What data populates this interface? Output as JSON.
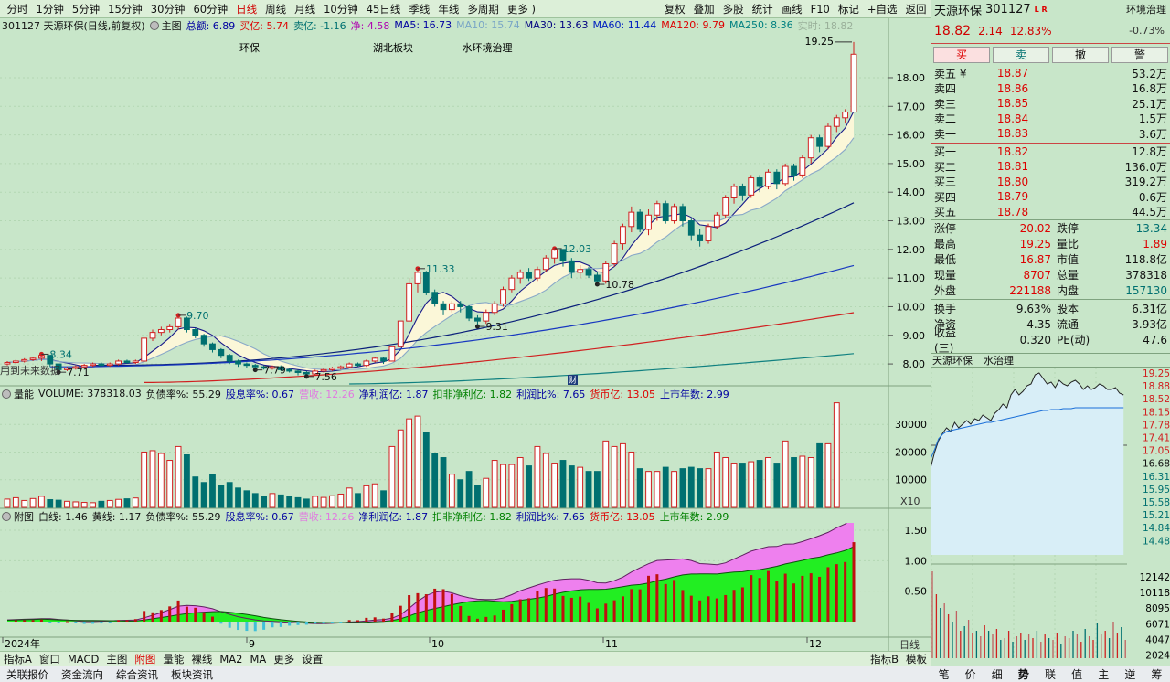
{
  "toolbar": {
    "items": [
      "分时",
      "1分钟",
      "5分钟",
      "15分钟",
      "30分钟",
      "60分钟",
      "日线",
      "周线",
      "月线",
      "10分钟",
      "45日线",
      "季线",
      "年线",
      "多周期",
      "更多 )"
    ],
    "active": "日线",
    "right": [
      "复权",
      "叠加",
      "多股",
      "统计",
      "画线",
      "F10",
      "标记",
      "+自选",
      "返回"
    ]
  },
  "info": {
    "code_name": "301127 天源环保(日线,前复权)",
    "main_label": "主图",
    "amount": "总额: 6.89",
    "buy_yi": "买亿: 5.74",
    "sell_yi": "卖亿: -1.16",
    "net": "净: 4.58",
    "ma5": "MA5: 16.73",
    "ma10": "MA10: 15.74",
    "ma30": "MA30: 13.63",
    "ma60": "MA60: 11.44",
    "ma120": "MA120: 9.79",
    "ma250": "MA250: 8.36",
    "realtime": "实时: 18.82"
  },
  "tags": [
    "环保",
    "湖北板块",
    "水环境治理"
  ],
  "chart_note": "用到未来数据",
  "vol_info": {
    "label": "量能",
    "volume": "VOLUME: 378318.03",
    "f1": "负债率%: 55.29",
    "f2": "股息率%: 0.67",
    "f3": "营收: 12.26",
    "f4": "净利润亿: 1.87",
    "f5": "扣非净利亿: 1.82",
    "f6": "利润比%: 7.65",
    "f7": "货币亿: 13.05",
    "f8": "上市年数: 2.99"
  },
  "sub_info": {
    "label": "附图",
    "white": "白线: 1.46",
    "yellow": "黄线: 1.17",
    "f1": "负债率%: 55.29",
    "f2": "股息率%: 0.67",
    "f3": "营收: 12.26",
    "f4": "净利润亿: 1.87",
    "f5": "扣非净利亿: 1.82",
    "f6": "利润比%: 7.65",
    "f7": "货币亿: 13.05",
    "f8": "上市年数: 2.99"
  },
  "bottom_bar": {
    "items": [
      "指标A",
      "窗口",
      "MACD",
      "主图",
      "附图",
      "量能",
      "裸线",
      "MA2",
      "MA",
      "更多",
      "设置"
    ],
    "active": "附图",
    "right": [
      "指标B",
      "模板"
    ]
  },
  "status_bar": [
    "关联报价",
    "资金流向",
    "综合资讯",
    "板块资讯"
  ],
  "side_labels": {
    "x10": "X10",
    "daily": "日线"
  },
  "quote": {
    "name": "天源环保",
    "code": "301127",
    "lr": "L R",
    "industry": "环境治理",
    "price": "18.82",
    "change": "2.14",
    "pct": "12.83%",
    "ind_pct": "-0.73%",
    "buttons": [
      "买",
      "卖",
      "撤",
      "警"
    ],
    "sell": [
      {
        "label": "卖五 ¥",
        "price": "18.87",
        "vol": "53.2万"
      },
      {
        "label": "卖四",
        "price": "18.86",
        "vol": "16.8万"
      },
      {
        "label": "卖三",
        "price": "18.85",
        "vol": "25.1万"
      },
      {
        "label": "卖二",
        "price": "18.84",
        "vol": "1.5万"
      },
      {
        "label": "卖一",
        "price": "18.83",
        "vol": "3.6万"
      }
    ],
    "buy": [
      {
        "label": "买一",
        "price": "18.82",
        "vol": "12.8万"
      },
      {
        "label": "买二",
        "price": "18.81",
        "vol": "136.0万"
      },
      {
        "label": "买三",
        "price": "18.80",
        "vol": "319.2万"
      },
      {
        "label": "买四",
        "price": "18.79",
        "vol": "0.6万"
      },
      {
        "label": "买五",
        "price": "18.78",
        "vol": "44.5万"
      }
    ],
    "stats": [
      {
        "a": "涨停",
        "b": "20.02",
        "c": "跌停",
        "d": "13.34"
      },
      {
        "a": "最高",
        "b": "19.25",
        "c": "量比",
        "d": "1.89"
      },
      {
        "a": "最低",
        "b": "16.87",
        "c": "市值",
        "d": "118.8亿"
      },
      {
        "a": "现量",
        "b": "8707",
        "c": "总量",
        "d": "378318"
      },
      {
        "a": "外盘",
        "b": "221188",
        "c": "内盘",
        "d": "157130"
      }
    ],
    "stats2": [
      {
        "a": "换手",
        "b": "9.63%",
        "c": "股本",
        "d": "6.31亿"
      },
      {
        "a": "净资",
        "b": "4.35",
        "c": "流通",
        "d": "3.93亿"
      },
      {
        "a": "收益(三)",
        "b": "0.320",
        "c": "PE(动)",
        "d": "47.6"
      }
    ]
  },
  "mini_tabs": [
    "天源环保",
    "水治理"
  ],
  "mini_axis": [
    "19.25",
    "18.88",
    "18.52",
    "18.15",
    "17.78",
    "17.41",
    "17.05",
    "16.68",
    "16.31",
    "15.95",
    "15.58",
    "15.21",
    "14.84",
    "14.48",
    "12142",
    "10118",
    "8095",
    "6071",
    "4047",
    "2024"
  ],
  "mini_tabs_bottom": [
    "笔",
    "价",
    "细",
    "势",
    "联",
    "值",
    "主",
    "逆",
    "筹"
  ],
  "mini_active": "势",
  "chart_data": {
    "type": "candlestick",
    "price_axis": [
      "18.00",
      "17.00",
      "16.00",
      "15.00",
      "14.00",
      "13.00",
      "12.00",
      "11.00",
      "10.00",
      "9.00",
      "8.00"
    ],
    "vol_axis": [
      "30000",
      "20000",
      "10000"
    ],
    "sub_axis": [
      "1.50",
      "1.00",
      "0.50"
    ],
    "date_labels": [
      "2024年",
      "9",
      "10",
      "11",
      "12"
    ],
    "annotations": [
      {
        "text": "8.34",
        "value": 8.34
      },
      {
        "text": "7.71",
        "value": 7.71
      },
      {
        "text": "9.70",
        "value": 9.7
      },
      {
        "text": "7.79",
        "value": 7.79
      },
      {
        "text": "7.56",
        "value": 7.56
      },
      {
        "text": "11.33",
        "value": 11.33
      },
      {
        "text": "9.31",
        "value": 9.31
      },
      {
        "text": "12.03",
        "value": 12.03
      },
      {
        "text": "10.78",
        "value": 10.78
      },
      {
        "text": "19.25",
        "value": 19.25
      }
    ],
    "candles": [
      [
        8,
        8.05,
        7.95,
        8.1
      ],
      [
        8.05,
        8.1,
        8.0,
        8.15
      ],
      [
        8.1,
        8.15,
        8.05,
        8.2
      ],
      [
        8.15,
        8.2,
        8.1,
        8.25
      ],
      [
        8.2,
        8.3,
        8.1,
        8.34
      ],
      [
        8.3,
        8.0,
        7.9,
        8.3
      ],
      [
        8.0,
        7.8,
        7.71,
        8.0
      ],
      [
        7.8,
        7.85,
        7.75,
        7.9
      ],
      [
        7.85,
        7.9,
        7.8,
        7.95
      ],
      [
        7.9,
        7.95,
        7.85,
        8.0
      ],
      [
        7.95,
        8.0,
        7.9,
        8.05
      ],
      [
        8.0,
        7.95,
        7.9,
        8.05
      ],
      [
        7.95,
        8.0,
        7.9,
        8.05
      ],
      [
        8.0,
        8.1,
        7.95,
        8.15
      ],
      [
        8.1,
        8.05,
        8.0,
        8.15
      ],
      [
        8.05,
        8.1,
        8.0,
        8.15
      ],
      [
        8.1,
        8.9,
        8.1,
        8.9
      ],
      [
        8.9,
        9.1,
        8.8,
        9.2
      ],
      [
        9.1,
        9.2,
        9.0,
        9.3
      ],
      [
        9.2,
        9.3,
        9.1,
        9.4
      ],
      [
        9.3,
        9.6,
        9.2,
        9.7
      ],
      [
        9.6,
        9.2,
        9.1,
        9.65
      ],
      [
        9.2,
        9.0,
        8.9,
        9.25
      ],
      [
        9.0,
        8.7,
        8.6,
        9.05
      ],
      [
        8.7,
        8.5,
        8.4,
        8.75
      ],
      [
        8.5,
        8.3,
        8.2,
        8.55
      ],
      [
        8.3,
        8.1,
        8.0,
        8.35
      ],
      [
        8.1,
        8.0,
        7.9,
        8.15
      ],
      [
        8.0,
        7.95,
        7.85,
        8.05
      ],
      [
        7.95,
        7.9,
        7.79,
        8.0
      ],
      [
        7.9,
        7.85,
        7.8,
        7.95
      ],
      [
        7.85,
        7.9,
        7.8,
        7.95
      ],
      [
        7.9,
        7.8,
        7.75,
        7.95
      ],
      [
        7.8,
        7.75,
        7.7,
        7.85
      ],
      [
        7.75,
        7.7,
        7.6,
        7.8
      ],
      [
        7.7,
        7.65,
        7.56,
        7.75
      ],
      [
        7.65,
        7.75,
        7.6,
        7.8
      ],
      [
        7.75,
        7.8,
        7.7,
        7.85
      ],
      [
        7.8,
        7.85,
        7.75,
        7.9
      ],
      [
        7.85,
        7.9,
        7.8,
        7.95
      ],
      [
        7.9,
        8.0,
        7.85,
        8.05
      ],
      [
        8.0,
        7.95,
        7.9,
        8.05
      ],
      [
        7.95,
        8.1,
        7.9,
        8.15
      ],
      [
        8.1,
        8.2,
        8.05,
        8.25
      ],
      [
        8.2,
        8.1,
        8.0,
        8.25
      ],
      [
        8.1,
        8.6,
        8.1,
        8.6
      ],
      [
        8.6,
        9.5,
        8.6,
        9.5
      ],
      [
        9.5,
        10.8,
        9.5,
        11.0
      ],
      [
        10.8,
        11.2,
        10.5,
        11.33
      ],
      [
        11.2,
        10.5,
        10.4,
        11.25
      ],
      [
        10.5,
        10.1,
        10.0,
        10.6
      ],
      [
        10.1,
        9.9,
        9.7,
        10.2
      ],
      [
        9.9,
        10.1,
        9.8,
        10.2
      ],
      [
        10.1,
        10.0,
        9.8,
        10.2
      ],
      [
        10.0,
        9.6,
        9.5,
        10.05
      ],
      [
        9.6,
        9.5,
        9.31,
        9.7
      ],
      [
        9.5,
        9.8,
        9.4,
        9.9
      ],
      [
        9.8,
        10.1,
        9.7,
        10.2
      ],
      [
        10.1,
        10.6,
        10.0,
        10.7
      ],
      [
        10.6,
        11.0,
        10.5,
        11.1
      ],
      [
        11.0,
        11.2,
        10.8,
        11.3
      ],
      [
        11.2,
        11.0,
        10.9,
        11.35
      ],
      [
        11.0,
        11.3,
        10.9,
        11.4
      ],
      [
        11.3,
        11.7,
        11.2,
        11.8
      ],
      [
        11.7,
        12.0,
        11.5,
        12.03
      ],
      [
        12.0,
        11.6,
        11.4,
        12.0
      ],
      [
        11.6,
        11.2,
        11.0,
        11.7
      ],
      [
        11.2,
        11.3,
        11.0,
        11.45
      ],
      [
        11.3,
        11.1,
        11.0,
        11.4
      ],
      [
        11.1,
        10.9,
        10.78,
        11.2
      ],
      [
        10.9,
        11.5,
        10.8,
        11.6
      ],
      [
        11.5,
        12.2,
        11.4,
        12.3
      ],
      [
        12.2,
        12.8,
        12.0,
        12.9
      ],
      [
        12.8,
        13.3,
        12.6,
        13.5
      ],
      [
        13.3,
        12.7,
        12.6,
        13.4
      ],
      [
        12.7,
        13.2,
        12.5,
        13.4
      ],
      [
        13.2,
        13.6,
        13.0,
        13.7
      ],
      [
        13.6,
        13.0,
        12.9,
        13.7
      ],
      [
        13.0,
        13.5,
        12.9,
        13.6
      ],
      [
        13.5,
        13.0,
        12.8,
        13.6
      ],
      [
        13.0,
        12.5,
        12.3,
        13.1
      ],
      [
        12.5,
        12.3,
        12.1,
        12.7
      ],
      [
        12.3,
        12.8,
        12.2,
        12.9
      ],
      [
        12.8,
        13.2,
        12.7,
        13.3
      ],
      [
        13.2,
        13.8,
        13.1,
        13.9
      ],
      [
        13.8,
        14.2,
        13.6,
        14.3
      ],
      [
        14.2,
        13.9,
        13.7,
        14.3
      ],
      [
        13.9,
        14.5,
        13.8,
        14.6
      ],
      [
        14.5,
        14.2,
        14.0,
        14.6
      ],
      [
        14.2,
        14.7,
        14.1,
        14.8
      ],
      [
        14.7,
        14.3,
        14.1,
        14.8
      ],
      [
        14.3,
        14.9,
        14.2,
        15.0
      ],
      [
        14.9,
        14.6,
        14.4,
        15.0
      ],
      [
        14.6,
        15.2,
        14.5,
        15.3
      ],
      [
        15.2,
        15.9,
        15.0,
        16.0
      ],
      [
        15.9,
        15.6,
        15.4,
        16.0
      ],
      [
        15.6,
        16.3,
        15.5,
        16.4
      ],
      [
        16.3,
        16.6,
        16.1,
        16.7
      ],
      [
        16.6,
        16.8,
        16.4,
        16.9
      ],
      [
        16.8,
        18.82,
        16.87,
        19.25
      ]
    ],
    "volumes": [
      3000,
      3500,
      2500,
      3200,
      4000,
      2800,
      2600,
      2200,
      2000,
      1800,
      1700,
      2200,
      2500,
      2900,
      3100,
      3400,
      20000,
      20500,
      19500,
      17000,
      22000,
      19000,
      11000,
      9000,
      12000,
      8000,
      9000,
      7000,
      6000,
      5000,
      4000,
      5000,
      4500,
      3800,
      3500,
      3000,
      4000,
      3600,
      4200,
      4800,
      7000,
      5000,
      7800,
      8500,
      6000,
      22000,
      28000,
      32000,
      33000,
      27000,
      19500,
      18000,
      12000,
      10000,
      13000,
      8000,
      10500,
      17000,
      15500,
      15500,
      18000,
      15000,
      22000,
      19500,
      16000,
      17000,
      15000,
      14500,
      13000,
      13000,
      24000,
      22000,
      23000,
      20000,
      14000,
      13000,
      13000,
      14500,
      13000,
      14000,
      14500,
      14000,
      14000,
      20000,
      18000,
      16000,
      16000,
      16500,
      17000,
      18000,
      16000,
      24000,
      18000,
      18500,
      18000,
      23000,
      23000,
      37800
    ],
    "vol_up": [
      true,
      true,
      true,
      true,
      true,
      false,
      false,
      true,
      true,
      true,
      true,
      false,
      true,
      true,
      false,
      true,
      true,
      true,
      true,
      true,
      true,
      false,
      false,
      false,
      false,
      false,
      false,
      false,
      false,
      false,
      false,
      true,
      false,
      false,
      false,
      false,
      true,
      true,
      true,
      true,
      true,
      false,
      true,
      true,
      false,
      true,
      true,
      true,
      true,
      false,
      false,
      false,
      true,
      false,
      false,
      false,
      true,
      true,
      true,
      true,
      true,
      false,
      true,
      true,
      true,
      false,
      false,
      true,
      false,
      false,
      true,
      true,
      true,
      true,
      false,
      true,
      true,
      false,
      true,
      false,
      false,
      false,
      true,
      true,
      true,
      true,
      false,
      true,
      false,
      true,
      false,
      true,
      false,
      true,
      true,
      false,
      true,
      true,
      true,
      true
    ]
  }
}
